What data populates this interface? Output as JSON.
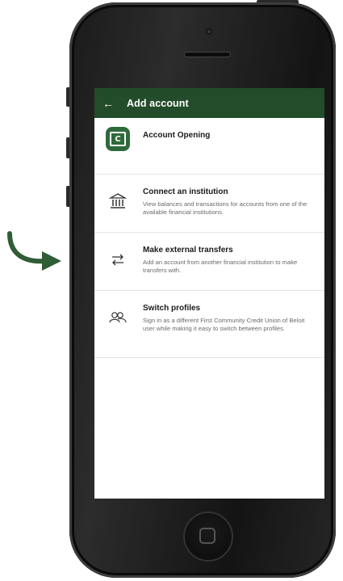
{
  "header": {
    "back_icon": "arrow-left-icon",
    "title": "Add account"
  },
  "items": [
    {
      "icon": "credit-union-logo-icon",
      "logo_text": "C",
      "title": "Account Opening",
      "description": ""
    },
    {
      "icon": "bank-institution-icon",
      "title": "Connect an institution",
      "description": "View balances and transactions for accounts from one of the available financial institutions."
    },
    {
      "icon": "transfer-arrows-icon",
      "title": "Make external transfers",
      "description": "Add an account from another financial institution to make transfers with."
    },
    {
      "icon": "users-icon",
      "title": "Switch profiles",
      "description": "Sign in as a different First Community Credit Union of Beloit user while making it easy to switch between profiles."
    }
  ],
  "colors": {
    "brand_green": "#234c2a",
    "logo_green": "#2f6a3b",
    "pointer_arrow": "#2f5d36"
  }
}
